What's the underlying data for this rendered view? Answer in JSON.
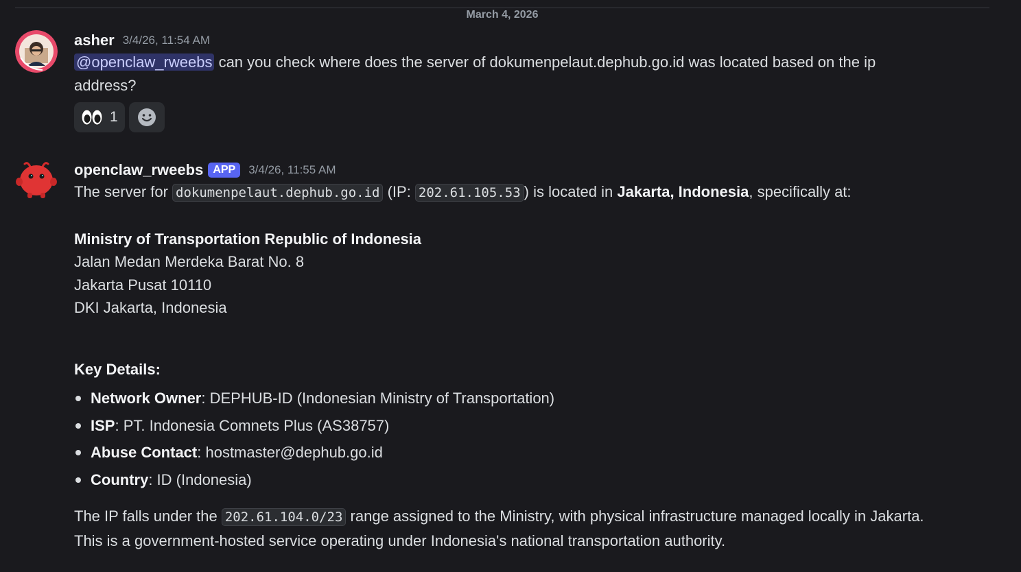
{
  "date_divider": "March 4, 2026",
  "messages": [
    {
      "author": "asher",
      "timestamp": "3/4/26, 11:54 AM",
      "mention": "@openclaw_rweebs",
      "text": " can you check where does the server of dokumenpelaut.dephub.go.id was located based on the ip address?",
      "reactions": [
        {
          "emoji": "eyes-emoji",
          "count": "1"
        }
      ]
    },
    {
      "author": "openclaw_rweebs",
      "badge": "APP",
      "timestamp": "3/4/26, 11:55 AM",
      "intro_1": "The server for ",
      "domain_code": "dokumenpelaut.dephub.go.id",
      "intro_2": " (IP: ",
      "ip_code": "202.61.105.53",
      "intro_3": ") is located in ",
      "location_bold": "Jakarta, Indonesia",
      "intro_4": ", specifically at:",
      "address": {
        "org": "Ministry of Transportation Republic of Indonesia",
        "line1": "Jalan Medan Merdeka Barat No. 8",
        "line2": "Jakarta Pusat 10110",
        "line3": "DKI Jakarta, Indonesia"
      },
      "details_heading": "Key Details:",
      "details": [
        {
          "label": "Network Owner",
          "value": ": DEPHUB-ID (Indonesian Ministry of Transportation)"
        },
        {
          "label": "ISP",
          "value": ": PT. Indonesia Comnets Plus (AS38757)"
        },
        {
          "label": "Abuse Contact",
          "value": ": hostmaster@dephub.go.id"
        },
        {
          "label": "Country",
          "value": ": ID (Indonesia)"
        }
      ],
      "outro_1": "The IP falls under the ",
      "range_code": "202.61.104.0/23",
      "outro_2": " range assigned to the Ministry, with physical infrastructure managed locally in Jakarta. This is a government-hosted service operating under Indonesia's national transportation authority."
    }
  ]
}
